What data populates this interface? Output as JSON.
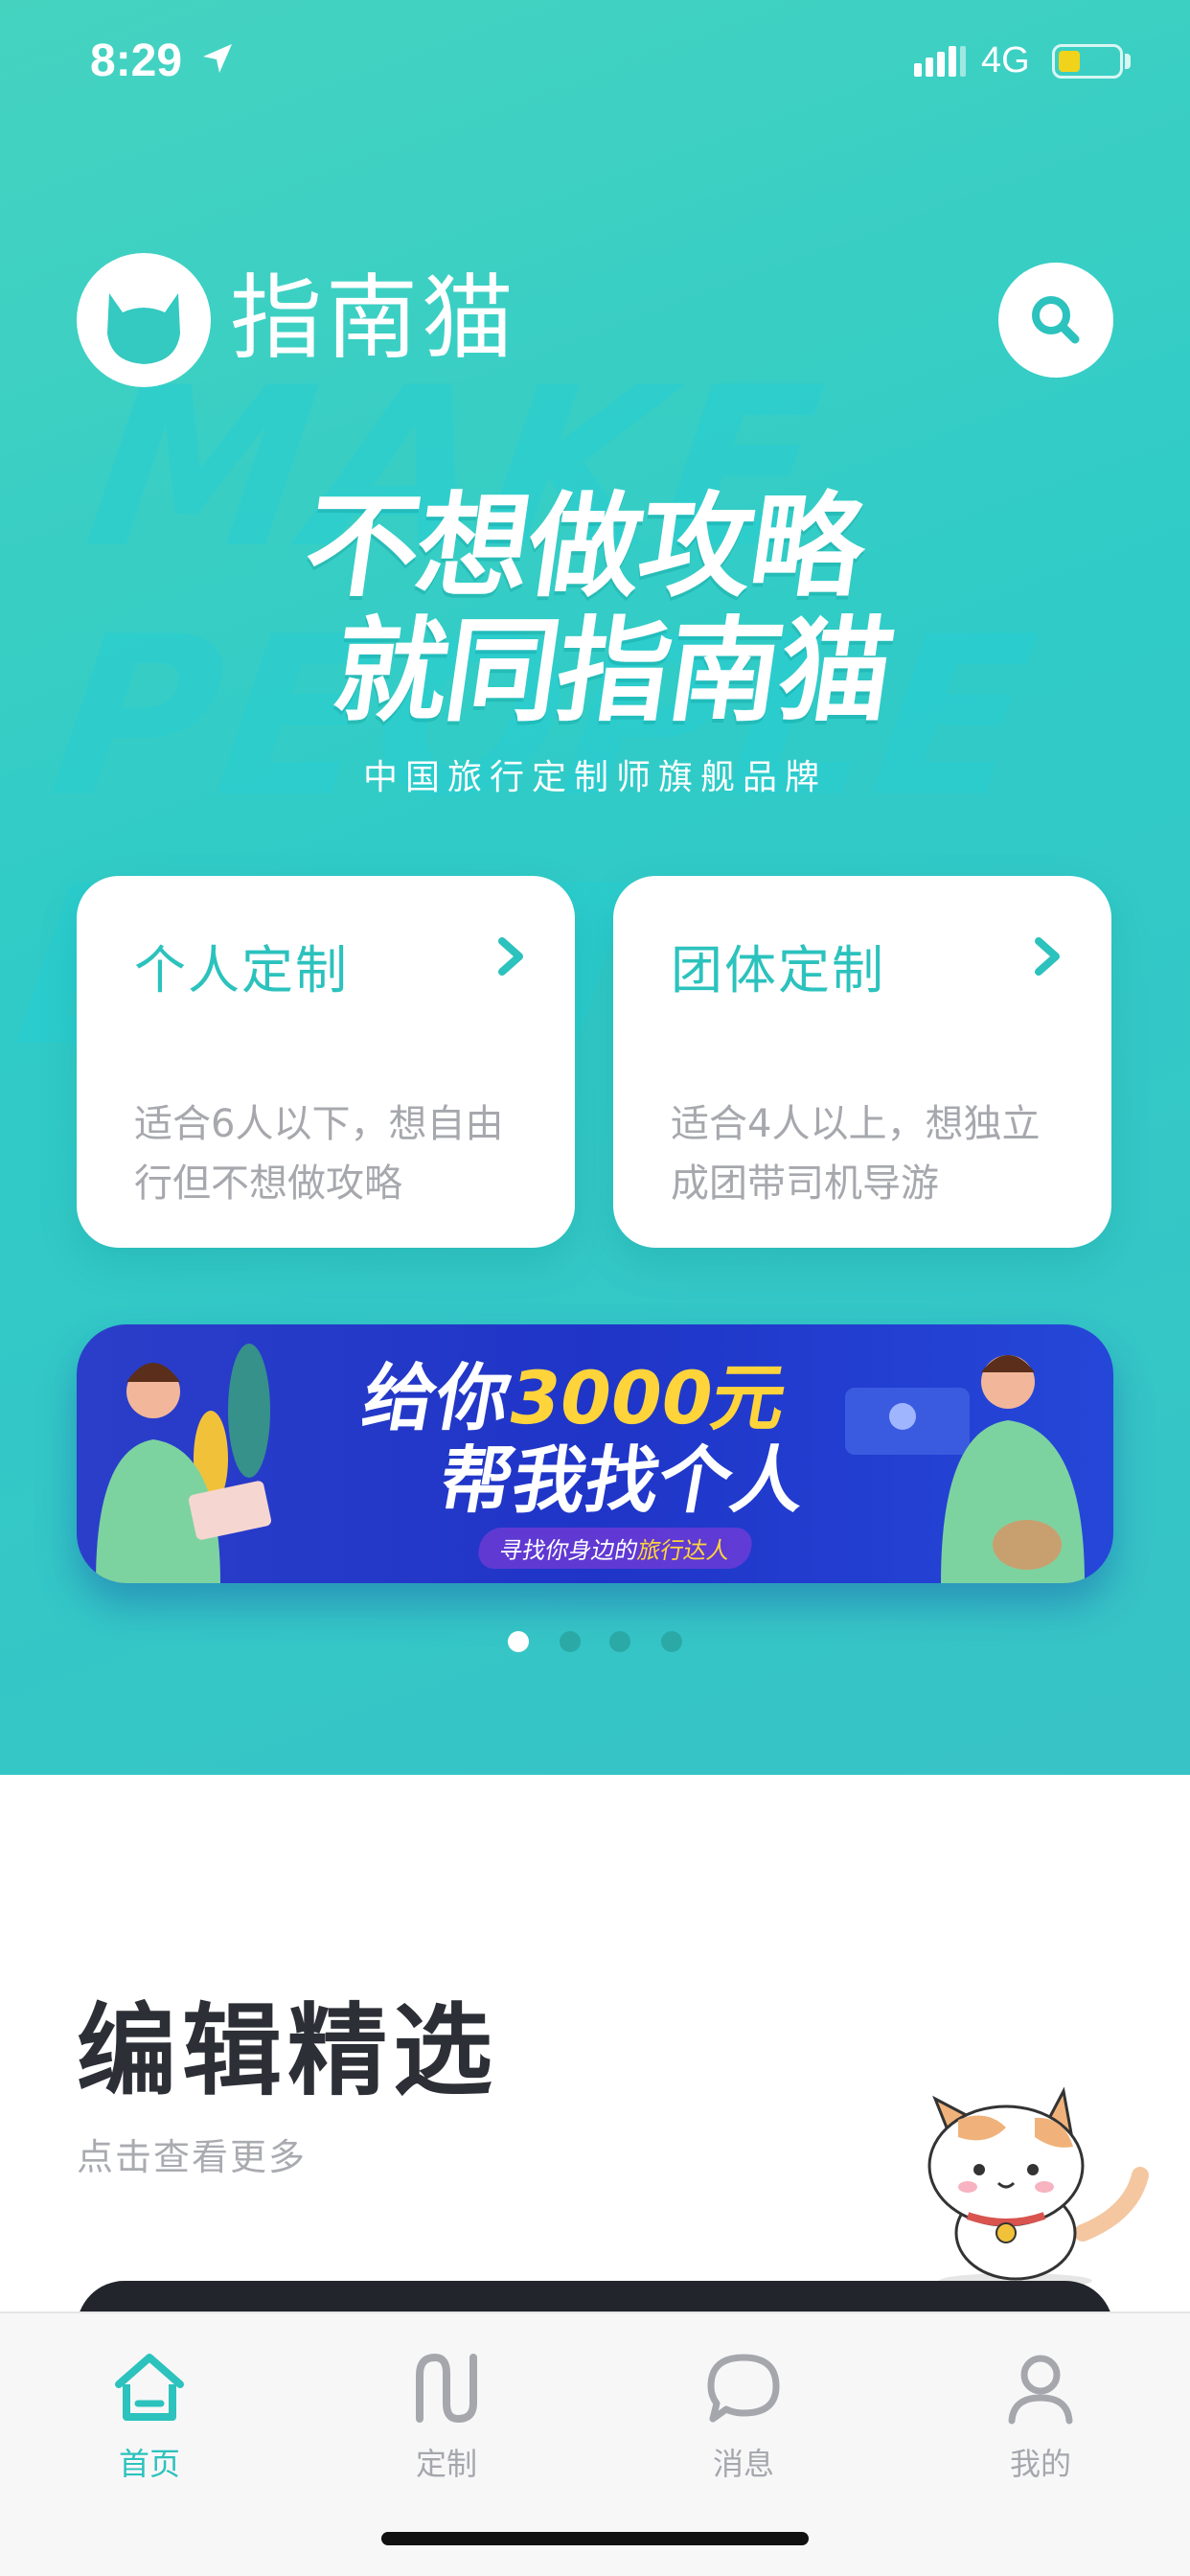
{
  "status_bar": {
    "time": "8:29",
    "network": "4G"
  },
  "header": {
    "app_title": "指南猫"
  },
  "slogan": {
    "line1": "不想做攻略",
    "line2": "就同指南猫",
    "subtitle": "中国旅行定制师旗舰品牌"
  },
  "watermark": "MAKE PEOPLE BETTER",
  "cards": [
    {
      "title": "个人定制",
      "description": "适合6人以下，想自由行但不想做攻略"
    },
    {
      "title": "团体定制",
      "description": "适合4人以上，想独立成团带司机导游"
    }
  ],
  "banner": {
    "line1_prefix": "给你",
    "line1_amount": "3000元",
    "line2": "帮我找个人",
    "sub_prefix": "寻找你身边的",
    "sub_highlight": "旅行达人",
    "page_count": 4,
    "active_page": 1
  },
  "section": {
    "title": "编辑精选",
    "subtitle": "点击查看更多"
  },
  "tabs": [
    {
      "label": "首页",
      "icon": "home-icon",
      "active": true
    },
    {
      "label": "定制",
      "icon": "custom-icon",
      "active": false
    },
    {
      "label": "消息",
      "icon": "message-icon",
      "active": false
    },
    {
      "label": "我的",
      "icon": "profile-icon",
      "active": false
    }
  ],
  "colors": {
    "accent": "#2cc2bd",
    "hero_top": "#45d3c0",
    "banner_bg": "#1f35c8",
    "highlight": "#ffd43a"
  }
}
